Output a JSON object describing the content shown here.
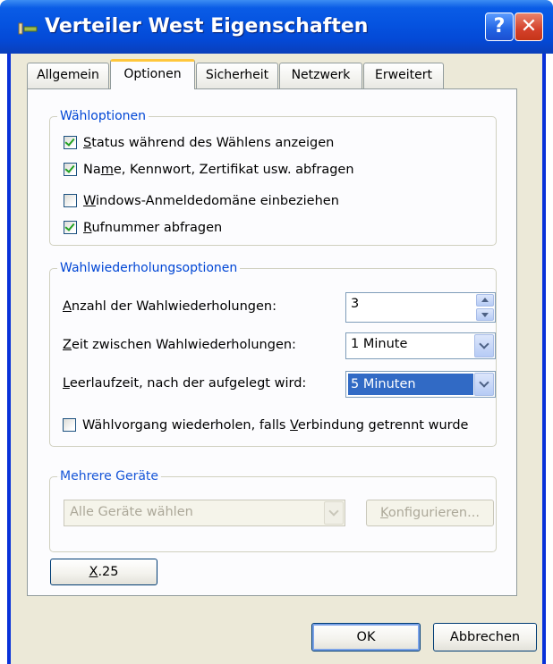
{
  "window": {
    "title": "Verteiler West Eigenschaften",
    "help_glyph": "?",
    "close_glyph": "✕"
  },
  "tabs": [
    {
      "label": "Allgemein",
      "active": false
    },
    {
      "label": "Optionen",
      "active": true
    },
    {
      "label": "Sicherheit",
      "active": false
    },
    {
      "label": "Netzwerk",
      "active": false
    },
    {
      "label": "Erweitert",
      "active": false
    }
  ],
  "dial_options": {
    "legend": "Wähloptionen",
    "items": [
      {
        "pre": "",
        "key": "S",
        "post": "tatus während des Wählens anzeigen",
        "checked": true
      },
      {
        "pre": "Na",
        "key": "m",
        "post": "e, Kennwort, Zertifikat usw. abfragen",
        "checked": true
      },
      {
        "pre": "",
        "key": "W",
        "post": "indows-Anmeldedomäne einbeziehen",
        "checked": false
      },
      {
        "pre": "",
        "key": "R",
        "post": "ufnummer abfragen",
        "checked": true
      }
    ]
  },
  "redial_options": {
    "legend": "Wahlwiederholungsoptionen",
    "redial_count": {
      "pre": "",
      "key": "A",
      "post": "nzahl der Wahlwiederholungen:",
      "value": "3"
    },
    "redial_interval": {
      "pre": "",
      "key": "Z",
      "post": "eit zwischen Wahlwiederholungen:",
      "value": "1 Minute"
    },
    "idle_time": {
      "pre": "",
      "key": "L",
      "post": "eerlaufzeit, nach der aufgelegt wird:",
      "value": "5 Minuten"
    },
    "redial_on_drop": {
      "pre": "Wählvorgang wiederholen, falls ",
      "key": "V",
      "post": "erbindung getrennt wurde",
      "checked": false
    }
  },
  "multiple_devices": {
    "legend": "Mehrere Geräte",
    "select_value": "Alle Geräte wählen",
    "configure": {
      "pre": "",
      "key": "K",
      "post": "onfigurieren..."
    }
  },
  "x25_button": {
    "pre": "",
    "key": "X",
    "post": ".25"
  },
  "footer": {
    "ok_label": "OK",
    "cancel_label": "Abbrechen"
  },
  "colors": {
    "accent_blue": "#0046d5",
    "checkmark_green": "#21a121",
    "selection": "#316ac5"
  }
}
